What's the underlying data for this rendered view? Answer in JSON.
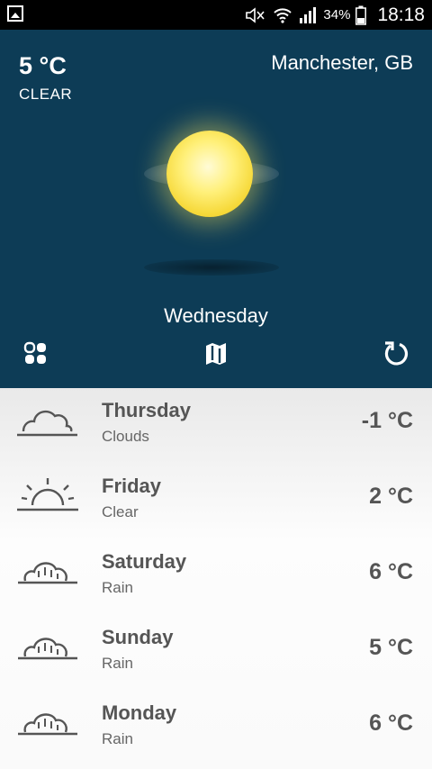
{
  "status_bar": {
    "battery_percent": "34%",
    "time": "18:18"
  },
  "current": {
    "temperature": "5 °C",
    "condition": "CLEAR",
    "location": "Manchester, GB",
    "day": "Wednesday",
    "icon": "sun-icon"
  },
  "actions": [
    {
      "name": "grid-view-icon"
    },
    {
      "name": "map-icon"
    },
    {
      "name": "refresh-icon"
    }
  ],
  "forecast": [
    {
      "day": "Thursday",
      "condition": "Clouds",
      "temp": "-1 °C",
      "icon": "cloud-icon"
    },
    {
      "day": "Friday",
      "condition": "Clear",
      "temp": "2 °C",
      "icon": "sunrise-icon"
    },
    {
      "day": "Saturday",
      "condition": "Rain",
      "temp": "6 °C",
      "icon": "rain-cloud-icon"
    },
    {
      "day": "Sunday",
      "condition": "Rain",
      "temp": "5 °C",
      "icon": "rain-cloud-icon"
    },
    {
      "day": "Monday",
      "condition": "Rain",
      "temp": "6 °C",
      "icon": "rain-cloud-icon"
    }
  ],
  "colors": {
    "hero_bg": "#0d3c56",
    "list_text": "#555555",
    "sun": "#f6d93a"
  }
}
